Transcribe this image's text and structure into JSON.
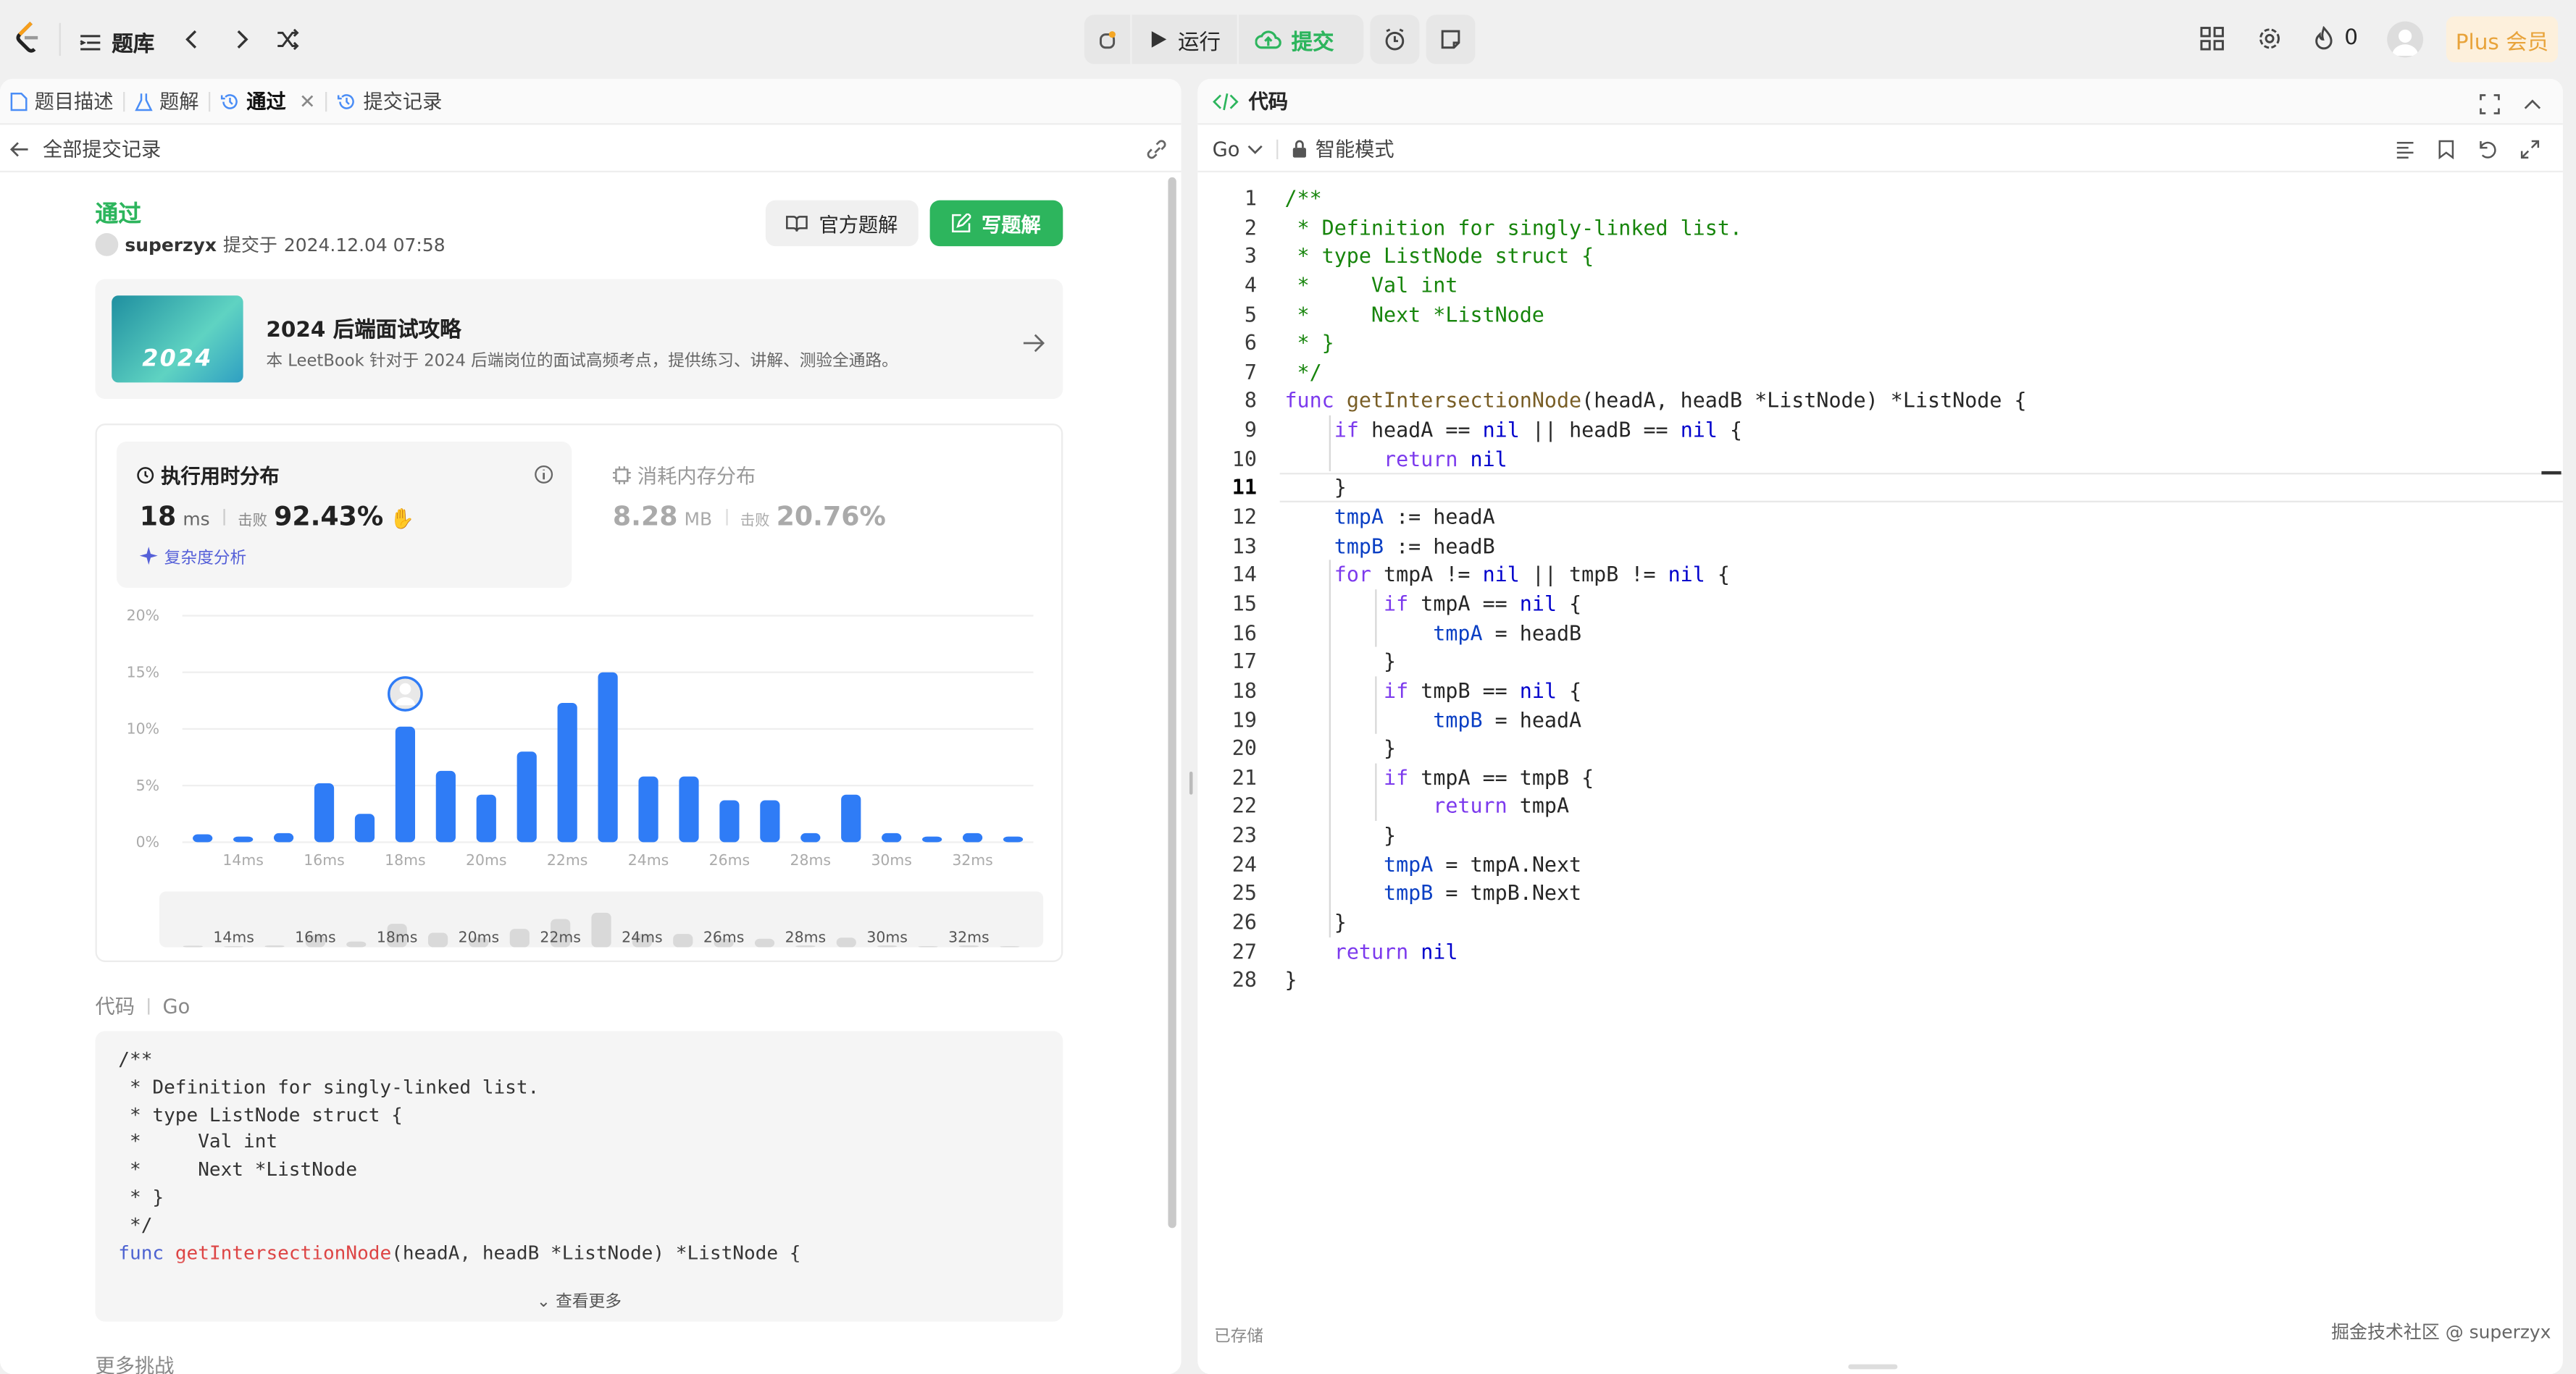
{
  "topbar": {
    "problem_bank_label": "题库",
    "run_label": "运行",
    "submit_label": "提交",
    "streak_count": "0",
    "plus_label": "Plus 会员"
  },
  "left": {
    "tabs": [
      {
        "label": "题目描述",
        "icon": "doc-icon"
      },
      {
        "label": "题解",
        "icon": "flask-icon"
      },
      {
        "label": "通过",
        "icon": "history-icon"
      },
      {
        "label": "提交记录",
        "icon": "history-icon"
      }
    ],
    "back_label": "全部提交记录",
    "status": "通过",
    "user": "superzyx",
    "submitted_prefix": "提交于",
    "submitted_time": "2024.12.04 07:58",
    "official_solution_label": "官方题解",
    "write_solution_label": "写题解",
    "book": {
      "cover_text": "2024",
      "title": "2024 后端面试攻略",
      "desc": "本 LeetBook 针对于 2024 后端岗位的面试高频考点，提供练习、讲解、测验全通路。"
    },
    "runtime": {
      "title": "执行用时分布",
      "value": "18",
      "unit": "ms",
      "beats_label": "击败",
      "beats": "92.43%",
      "complexity_label": "复杂度分析"
    },
    "memory": {
      "title": "消耗内存分布",
      "value": "8.28",
      "unit": "MB",
      "beats_label": "击败",
      "beats": "20.76%"
    },
    "code_label": "代码",
    "code_lang": "Go",
    "code_preview": [
      "/**",
      " * Definition for singly-linked list.",
      " * type ListNode struct {",
      " *     Val int",
      " *     Next *ListNode",
      " * }",
      " */",
      "func getIntersectionNode(headA, headB *ListNode) *ListNode {"
    ],
    "see_more_label": "查看更多",
    "more_challenges_label": "更多挑战"
  },
  "chart_data": {
    "type": "bar",
    "ylabel": "",
    "xlabel": "",
    "ylim": [
      0,
      20
    ],
    "yticks": [
      "20%",
      "15%",
      "10%",
      "5%",
      "0%"
    ],
    "xtick_labels": [
      "14ms",
      "16ms",
      "18ms",
      "20ms",
      "22ms",
      "24ms",
      "26ms",
      "28ms",
      "30ms",
      "32ms"
    ],
    "categories": [
      "13ms",
      "14ms",
      "15ms",
      "16ms",
      "17ms",
      "18ms",
      "19ms",
      "20ms",
      "21ms",
      "22ms",
      "23ms",
      "24ms",
      "25ms",
      "26ms",
      "27ms",
      "28ms",
      "29ms",
      "30ms",
      "31ms",
      "32ms",
      "33ms"
    ],
    "values": [
      0.7,
      0.5,
      0.8,
      5.2,
      2.5,
      10.2,
      6.3,
      4.2,
      8.0,
      12.3,
      15.0,
      5.8,
      5.8,
      3.7,
      3.7,
      0.8,
      4.2,
      0.8,
      0.5,
      0.8,
      0.5
    ],
    "highlight_category": "18ms",
    "minimap_labels": [
      "14ms",
      "16ms",
      "18ms",
      "20ms",
      "22ms",
      "24ms",
      "26ms",
      "28ms",
      "30ms",
      "32ms"
    ]
  },
  "editor": {
    "title": "代码",
    "lang": "Go",
    "mode_label": "智能模式",
    "saved_label": "已存储",
    "watermark": "掘金技术社区 @ superzyx",
    "lines": [
      "/**",
      " * Definition for singly-linked list.",
      " * type ListNode struct {",
      " *     Val int",
      " *     Next *ListNode",
      " * }",
      " */",
      "func getIntersectionNode(headA, headB *ListNode) *ListNode {",
      "    if headA == nil || headB == nil {",
      "        return nil",
      "    }",
      "    tmpA := headA",
      "    tmpB := headB",
      "    for tmpA != nil || tmpB != nil {",
      "        if tmpA == nil {",
      "            tmpA = headB",
      "        }",
      "        if tmpB == nil {",
      "            tmpB = headA",
      "        }",
      "        if tmpA == tmpB {",
      "            return tmpA",
      "        }",
      "        tmpA = tmpA.Next",
      "        tmpB = tmpB.Next",
      "    }",
      "    return nil",
      "}"
    ]
  }
}
